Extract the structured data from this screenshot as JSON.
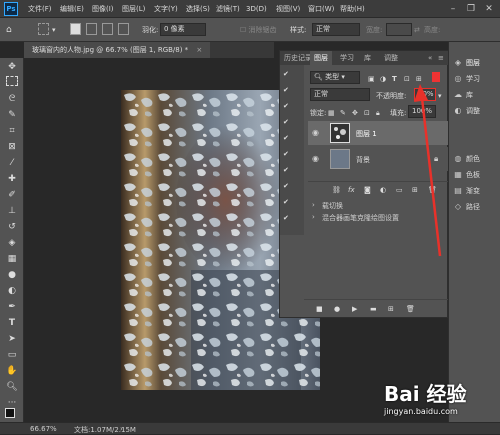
{
  "menubar": {
    "items": [
      "文件(F)",
      "编辑(E)",
      "图像(I)",
      "图层(L)",
      "文字(Y)",
      "选择(S)",
      "滤镜(T)",
      "3D(D)",
      "视图(V)",
      "窗口(W)",
      "帮助(H)"
    ],
    "logo": "Ps"
  },
  "options": {
    "feather_label": "羽化:",
    "feather_value": "0 像素",
    "style_label": "样式:",
    "style_value": "正常",
    "width_label": "宽度:",
    "height_label": "高度:"
  },
  "document": {
    "tab_title": "玻璃窗内的人物.jpg @ 66.7% (图层 1, RGB/8) *"
  },
  "panel_tabs": [
    "历史记录",
    "图层",
    "学习",
    "库",
    "调整"
  ],
  "layers_panel": {
    "filter_label": "类型",
    "blend_mode": "正常",
    "opacity_label": "不透明度:",
    "opacity_value": "40%",
    "lock_label": "锁定:",
    "fill_label": "填充:",
    "fill_value": "100%",
    "layers": [
      {
        "name": "图层 1"
      },
      {
        "name": "背景"
      }
    ]
  },
  "history_panel": {
    "items": [
      "载切换 ",
      "混合器画笔克隆绘图设置"
    ]
  },
  "right_panels": {
    "items": [
      "图层",
      "学习",
      "库",
      "调整",
      "颜色",
      "色板",
      "渐变",
      "路径"
    ]
  },
  "status": {
    "zoom": "66.67%",
    "doc_info": "文档:1.07M/2.15M"
  },
  "watermark": {
    "line1": "Bai 经验",
    "line2": "jingyan.baidu.com"
  },
  "colors": {
    "arrow": "#e8312a",
    "highlight": "#e8312a"
  }
}
